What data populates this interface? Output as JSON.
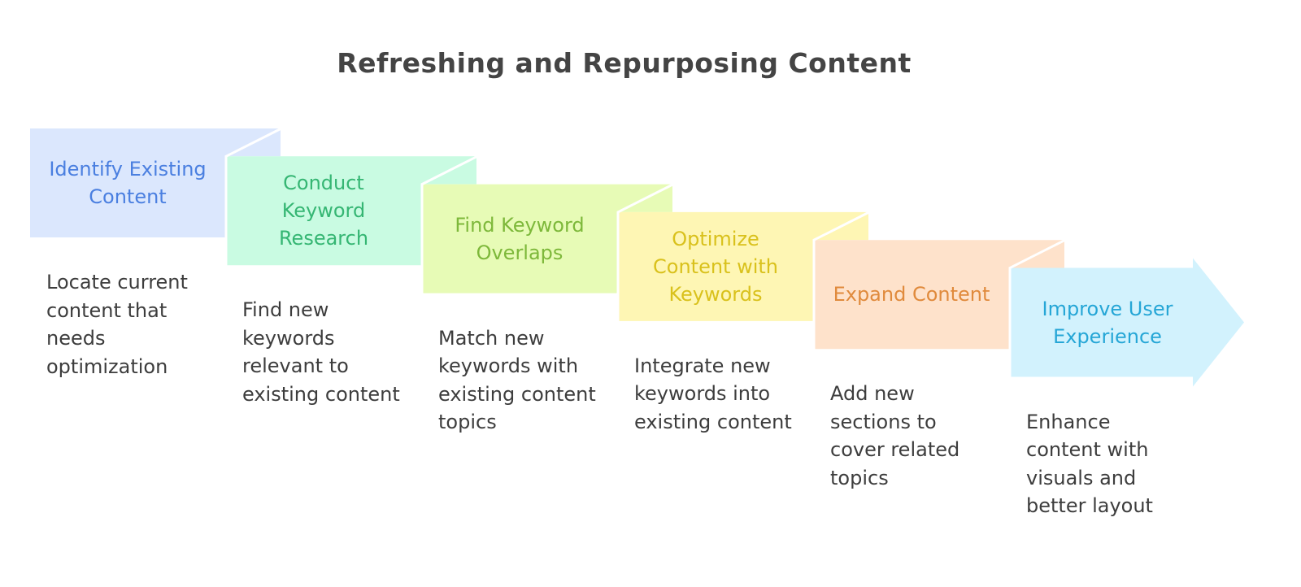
{
  "title": "Refreshing and Repurposing Content",
  "steps": [
    {
      "label": "Identify Existing Content",
      "description": "Locate current content that needs optimization",
      "fill": "#dbe7fd",
      "text_color": "#4a7fe0"
    },
    {
      "label": "Conduct Keyword Research",
      "description": "Find new keywords relevant to existing content",
      "fill": "#c9fbe2",
      "text_color": "#35b673"
    },
    {
      "label": "Find Keyword Overlaps",
      "description": "Match new keywords with existing content topics",
      "fill": "#e7fbb6",
      "text_color": "#7db83a"
    },
    {
      "label": "Optimize Content with Keywords",
      "description": "Integrate new keywords into existing content",
      "fill": "#fef6b4",
      "text_color": "#d9c11c"
    },
    {
      "label": "Expand Content",
      "description": "Add new sections to cover related topics",
      "fill": "#fee2cb",
      "text_color": "#e08a3c"
    },
    {
      "label": "Improve User Experience",
      "description": "Enhance content with visuals and better layout",
      "fill": "#d2f2fd",
      "text_color": "#25a6d6"
    }
  ]
}
